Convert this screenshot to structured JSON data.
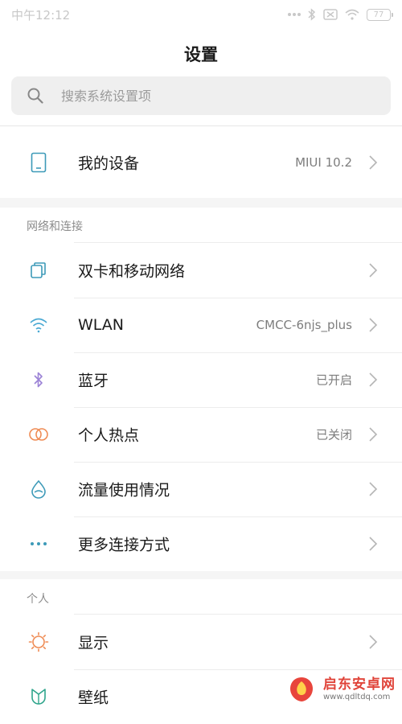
{
  "status_bar": {
    "time": "中午12:12",
    "battery": "77"
  },
  "header": {
    "title": "设置"
  },
  "search": {
    "placeholder": "搜索系统设置项"
  },
  "device": {
    "label": "我的设备",
    "value": "MIUI 10.2",
    "icon": "phone-icon"
  },
  "sections": [
    {
      "title": "网络和连接",
      "items": [
        {
          "label": "双卡和移动网络",
          "value": "",
          "icon": "sim-card-icon"
        },
        {
          "label": "WLAN",
          "value": "CMCC-6njs_plus",
          "icon": "wifi-icon"
        },
        {
          "label": "蓝牙",
          "value": "已开启",
          "icon": "bluetooth-icon"
        },
        {
          "label": "个人热点",
          "value": "已关闭",
          "icon": "hotspot-icon"
        },
        {
          "label": "流量使用情况",
          "value": "",
          "icon": "data-drop-icon"
        },
        {
          "label": "更多连接方式",
          "value": "",
          "icon": "more-dots-icon"
        }
      ]
    },
    {
      "title": "个人",
      "items": [
        {
          "label": "显示",
          "value": "",
          "icon": "sun-icon"
        },
        {
          "label": "壁纸",
          "value": "",
          "icon": "wallpaper-icon"
        }
      ]
    }
  ],
  "watermark": {
    "name": "启东安卓网",
    "url": "www.qdltdq.com"
  },
  "colors": {
    "teal": "#3d9ab8",
    "purple": "#9b82d6",
    "orange": "#ef8c55",
    "wifi": "#4aa9d3"
  }
}
